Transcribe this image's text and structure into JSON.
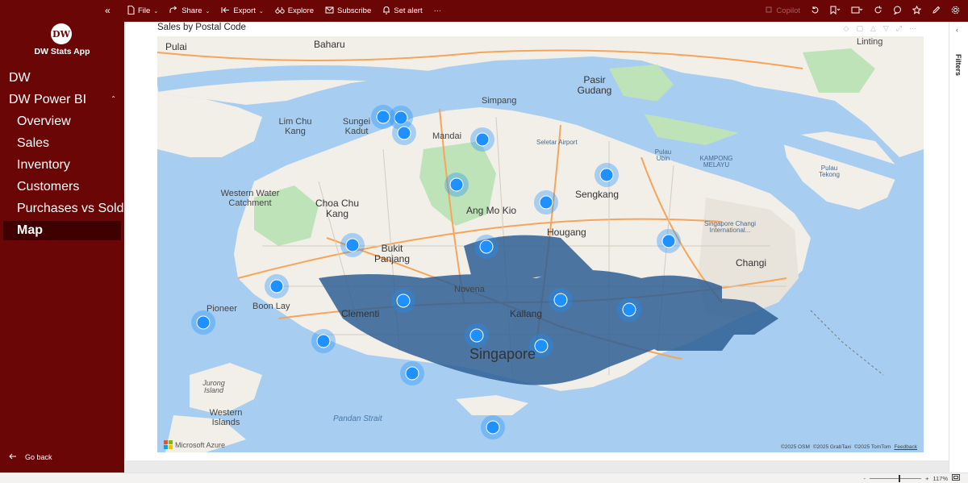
{
  "topbar": {
    "menu": [
      {
        "label": "File",
        "icon": "file-icon",
        "chevron": true
      },
      {
        "label": "Share",
        "icon": "share-icon",
        "chevron": true
      },
      {
        "label": "Export",
        "icon": "export-icon",
        "chevron": true
      },
      {
        "label": "Explore",
        "icon": "explore-icon",
        "chevron": false
      },
      {
        "label": "Subscribe",
        "icon": "subscribe-icon",
        "chevron": false
      },
      {
        "label": "Set alert",
        "icon": "bell-icon",
        "chevron": false
      }
    ],
    "more": "···",
    "copilot": "Copilot"
  },
  "sidebar": {
    "logo_text": "DW",
    "app_title": "DW Stats App",
    "items": [
      {
        "label": "DW",
        "level": 0
      },
      {
        "label": "DW Power BI",
        "level": 0,
        "expanded": true
      },
      {
        "label": "Overview",
        "level": 1
      },
      {
        "label": "Sales",
        "level": 1
      },
      {
        "label": "Inventory",
        "level": 1
      },
      {
        "label": "Customers",
        "level": 1
      },
      {
        "label": "Purchases vs Sold",
        "level": 1
      },
      {
        "label": "Map",
        "level": 1,
        "active": true
      }
    ],
    "go_back": "Go back"
  },
  "visual": {
    "title": "Sales by Postal Code"
  },
  "filters": {
    "label": "Filters"
  },
  "map": {
    "labels": [
      {
        "text": "Pulai",
        "type": "area"
      },
      {
        "text": "Baharu",
        "type": "area"
      },
      {
        "text": "Pasir Gudang",
        "type": "area"
      },
      {
        "text": "Linting",
        "type": "normal"
      },
      {
        "text": "Simpang",
        "type": "normal"
      },
      {
        "text": "Lim Chu Kang",
        "type": "normal"
      },
      {
        "text": "Sungei Kadut",
        "type": "normal"
      },
      {
        "text": "Mandai",
        "type": "normal"
      },
      {
        "text": "Seletar Airport",
        "type": "small"
      },
      {
        "text": "Pulau Ubin",
        "type": "small"
      },
      {
        "text": "KAMPONG MELAYU",
        "type": "small"
      },
      {
        "text": "Pulau Tekong",
        "type": "small"
      },
      {
        "text": "Western Water Catchment",
        "type": "normal"
      },
      {
        "text": "Choa Chu Kang",
        "type": "area"
      },
      {
        "text": "Sengkang",
        "type": "area"
      },
      {
        "text": "Ang Mo Kio",
        "type": "area"
      },
      {
        "text": "Hougang",
        "type": "area"
      },
      {
        "text": "Singapore Changi International...",
        "type": "small"
      },
      {
        "text": "Changi",
        "type": "area"
      },
      {
        "text": "Bukit Panjang",
        "type": "area"
      },
      {
        "text": "Novena",
        "type": "normal"
      },
      {
        "text": "Pioneer",
        "type": "normal"
      },
      {
        "text": "Boon Lay",
        "type": "normal"
      },
      {
        "text": "Clementi",
        "type": "area"
      },
      {
        "text": "Kallang",
        "type": "area"
      },
      {
        "text": "Singapore",
        "type": "big"
      },
      {
        "text": "Jurong Island",
        "type": "island"
      },
      {
        "text": "Western Islands",
        "type": "normal"
      },
      {
        "text": "Pandan Strait",
        "type": "water"
      }
    ],
    "attribution": [
      "©2025 OSM",
      "©2025 GrabTaxi",
      "©2025 TomTom",
      "Feedback"
    ],
    "provider": "Microsoft Azure",
    "bubble_color": "#1e90ff"
  },
  "statusbar": {
    "zoom_minus": "-",
    "zoom_plus": "+",
    "zoom_level": "117%"
  },
  "colors": {
    "sidebar_bg": "#6b0606",
    "sidebar_active": "#3e0000",
    "land": "#f2efe9",
    "park": "#bfe3b8",
    "water": "#a7cdf0",
    "road": "#f5a55a",
    "bubble": "#1e90ff",
    "density": "#2f5f94"
  }
}
